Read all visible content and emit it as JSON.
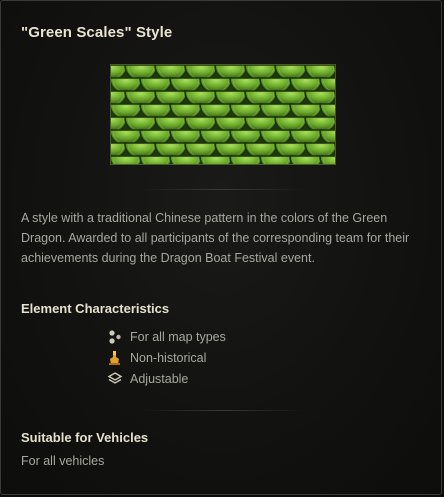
{
  "window": {
    "title": "\"Green Scales\" Style"
  },
  "preview": {
    "icon": "green-dragon-scale-pattern",
    "colors": {
      "base": "#1f3a10",
      "scale_light": "#9fdc4a",
      "scale_mid": "#5f9e24",
      "scale_dark": "#1c330b"
    }
  },
  "description": "A style with a traditional Chinese pattern in the colors of the Green Dragon. Awarded to all participants of the corresponding team for their achievements during the Dragon Boat Festival event.",
  "element_characteristics": {
    "heading": "Element Characteristics",
    "items": [
      {
        "icon": "all-map-types-icon",
        "label": "For all map types"
      },
      {
        "icon": "non-historical-icon",
        "label": "Non-historical"
      },
      {
        "icon": "adjustable-icon",
        "label": "Adjustable"
      }
    ]
  },
  "vehicles": {
    "heading": "Suitable for Vehicles",
    "text": "For all vehicles"
  }
}
